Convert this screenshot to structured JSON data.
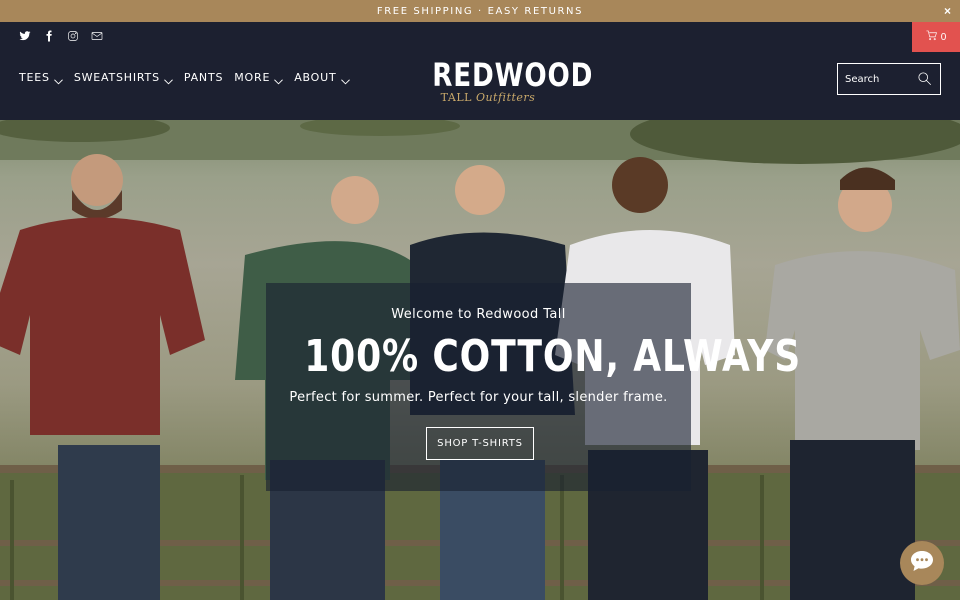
{
  "announcement": {
    "text": "FREE SHIPPING · EASY RETURNS",
    "close_icon": "×"
  },
  "social": [
    "twitter-icon",
    "facebook-icon",
    "instagram-icon",
    "email-icon"
  ],
  "cart": {
    "count": "0",
    "icon": "cart-icon"
  },
  "nav": {
    "items": [
      {
        "label": "TEES",
        "dropdown": true
      },
      {
        "label": "SWEATSHIRTS",
        "dropdown": true
      },
      {
        "label": "PANTS",
        "dropdown": false
      },
      {
        "label": "MORE",
        "dropdown": true
      },
      {
        "label": "ABOUT",
        "dropdown": true
      }
    ]
  },
  "logo": {
    "main": "REDWOOD",
    "sub_a": "TALL",
    "sub_b": "Outfitters"
  },
  "search": {
    "placeholder": "Search"
  },
  "hero": {
    "eyebrow": "Welcome to Redwood Tall",
    "title": "100% COTTON, ALWAYS",
    "description": "Perfect for summer. Perfect for your tall, slender frame.",
    "button_label": "SHOP T-SHIRTS"
  },
  "colors": {
    "header_bg": "#1c2030",
    "announce_bg": "#a8875a",
    "cart_bg": "#e2524f",
    "accent_gold": "#c8a86a"
  },
  "chat": {
    "icon": "chat-bubble-icon"
  }
}
